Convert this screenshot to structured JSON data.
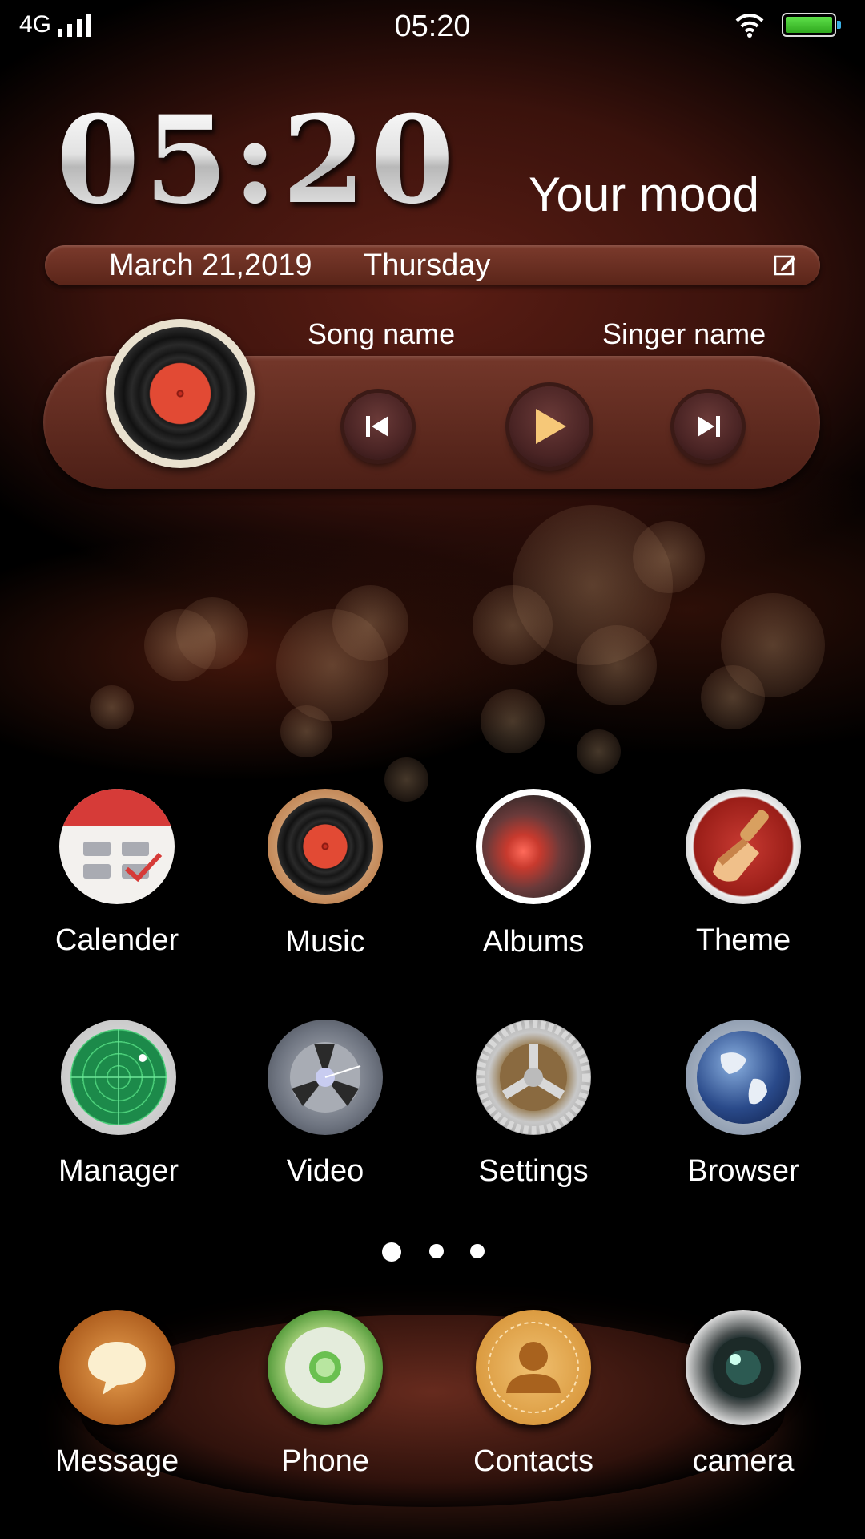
{
  "status_bar": {
    "network": "4G",
    "time": "05:20"
  },
  "widget": {
    "clock": "05:20",
    "mood": "Your mood",
    "date": "March 21,2019",
    "weekday": "Thursday"
  },
  "music": {
    "song_name": "Song name",
    "singer_name": "Singer name"
  },
  "apps": {
    "calender": "Calender",
    "music": "Music",
    "albums": "Albums",
    "theme": "Theme",
    "manager": "Manager",
    "video": "Video",
    "settings": "Settings",
    "browser": "Browser"
  },
  "dock": {
    "message": "Message",
    "phone": "Phone",
    "contacts": "Contacts",
    "camera": "camera"
  },
  "pager": {
    "pages": 3,
    "current": 1
  }
}
